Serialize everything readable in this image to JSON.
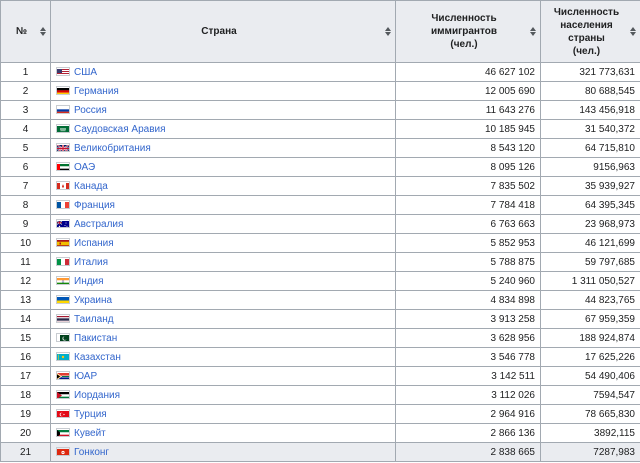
{
  "headers": {
    "num": "№",
    "country": "Страна",
    "immigrants": [
      "Численность",
      "иммигрантов",
      "(чел.)"
    ],
    "population": [
      "Численность",
      "населения",
      "страны",
      "(чел.)"
    ]
  },
  "rows": [
    {
      "n": "1",
      "country": "США",
      "immigrants": "46 627 102",
      "population": "321 773,631",
      "flag": "usa-flag-icon"
    },
    {
      "n": "2",
      "country": "Германия",
      "immigrants": "12 005 690",
      "population": "80 688,545",
      "flag": "germany-flag-icon"
    },
    {
      "n": "3",
      "country": "Россия",
      "immigrants": "11 643 276",
      "population": "143 456,918",
      "flag": "russia-flag-icon"
    },
    {
      "n": "4",
      "country": "Саудовская Аравия",
      "immigrants": "10 185 945",
      "population": "31 540,372",
      "flag": "saudi-arabia-flag-icon"
    },
    {
      "n": "5",
      "country": "Великобритания",
      "immigrants": "8 543 120",
      "population": "64 715,810",
      "flag": "uk-flag-icon"
    },
    {
      "n": "6",
      "country": "ОАЭ",
      "immigrants": "8 095 126",
      "population": "9156,963",
      "flag": "uae-flag-icon"
    },
    {
      "n": "7",
      "country": "Канада",
      "immigrants": "7 835 502",
      "population": "35 939,927",
      "flag": "canada-flag-icon"
    },
    {
      "n": "8",
      "country": "Франция",
      "immigrants": "7 784 418",
      "population": "64 395,345",
      "flag": "france-flag-icon"
    },
    {
      "n": "9",
      "country": "Австралия",
      "immigrants": "6 763 663",
      "population": "23 968,973",
      "flag": "australia-flag-icon"
    },
    {
      "n": "10",
      "country": "Испания",
      "immigrants": "5 852 953",
      "population": "46 121,699",
      "flag": "spain-flag-icon"
    },
    {
      "n": "11",
      "country": "Италия",
      "immigrants": "5 788 875",
      "population": "59 797,685",
      "flag": "italy-flag-icon"
    },
    {
      "n": "12",
      "country": "Индия",
      "immigrants": "5 240 960",
      "population": "1 311 050,527",
      "flag": "india-flag-icon"
    },
    {
      "n": "13",
      "country": "Украина",
      "immigrants": "4 834 898",
      "population": "44 823,765",
      "flag": "ukraine-flag-icon"
    },
    {
      "n": "14",
      "country": "Таиланд",
      "immigrants": "3 913 258",
      "population": "67 959,359",
      "flag": "thailand-flag-icon"
    },
    {
      "n": "15",
      "country": "Пакистан",
      "immigrants": "3 628 956",
      "population": "188 924,874",
      "flag": "pakistan-flag-icon"
    },
    {
      "n": "16",
      "country": "Казахстан",
      "immigrants": "3 546 778",
      "population": "17 625,226",
      "flag": "kazakhstan-flag-icon"
    },
    {
      "n": "17",
      "country": "ЮАР",
      "immigrants": "3 142 511",
      "population": "54 490,406",
      "flag": "south-africa-flag-icon"
    },
    {
      "n": "18",
      "country": "Иордания",
      "immigrants": "3 112 026",
      "population": "7594,547",
      "flag": "jordan-flag-icon"
    },
    {
      "n": "19",
      "country": "Турция",
      "immigrants": "2 964 916",
      "population": "78 665,830",
      "flag": "turkey-flag-icon"
    },
    {
      "n": "20",
      "country": "Кувейт",
      "immigrants": "2 866 136",
      "population": "3892,115",
      "flag": "kuwait-flag-icon"
    },
    {
      "n": "21",
      "country": "Гонконг",
      "immigrants": "2 838 665",
      "population": "7287,983",
      "flag": "hong-kong-flag-icon"
    }
  ]
}
